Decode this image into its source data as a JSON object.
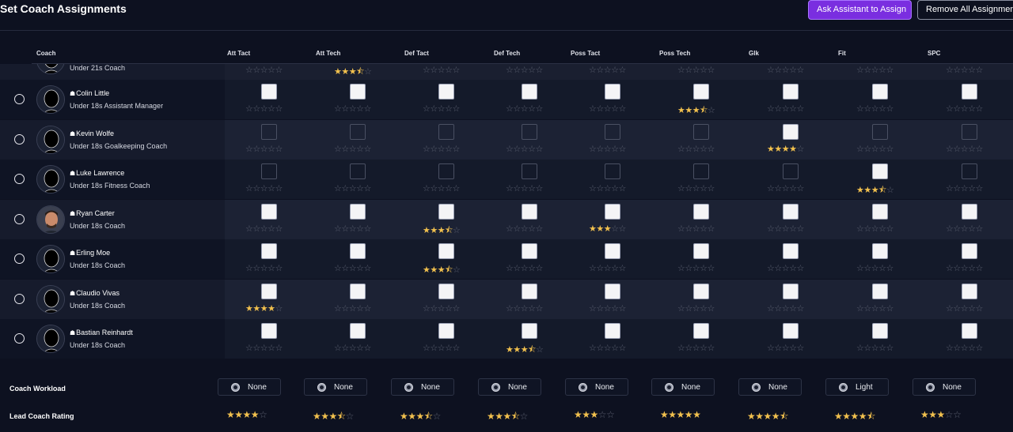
{
  "header": {
    "title": "Set Coach Assignments",
    "ask_assistant_label": "Ask Assistant to Assign",
    "remove_all_label": "Remove All Assignments"
  },
  "columns": {
    "coach": "Coach",
    "categories": [
      "Att Tact",
      "Att Tech",
      "Def Tact",
      "Def Tech",
      "Poss Tact",
      "Poss Tech",
      "Glk",
      "Fit",
      "SPC"
    ]
  },
  "colors": {
    "accent": "#7a2ee0",
    "star": "#f2c14e",
    "background": "#0d1120"
  },
  "partial_row": {
    "role": "Under 21s Coach",
    "ratings": [
      0,
      3.5,
      0,
      0,
      0,
      0,
      0,
      0,
      0
    ]
  },
  "rows": [
    {
      "name": "Colin Little",
      "role": "Under 18s Assistant Manager",
      "avatar": "silhouette",
      "checkboxes": [
        1,
        1,
        1,
        1,
        1,
        1,
        1,
        1,
        1
      ],
      "ratings": [
        0,
        0,
        0,
        0,
        0,
        3.5,
        0,
        0,
        0
      ]
    },
    {
      "name": "Kevin Wolfe",
      "role": "Under 18s Goalkeeping Coach",
      "avatar": "silhouette",
      "checkboxes": [
        0,
        0,
        0,
        0,
        0,
        0,
        1,
        0,
        0
      ],
      "ratings": [
        0,
        0,
        0,
        0,
        0,
        0,
        4,
        0,
        0
      ]
    },
    {
      "name": "Luke Lawrence",
      "role": "Under 18s Fitness Coach",
      "avatar": "silhouette",
      "checkboxes": [
        0,
        0,
        0,
        0,
        0,
        0,
        0,
        1,
        0
      ],
      "ratings": [
        0,
        0,
        0,
        0,
        0,
        0,
        0,
        3.5,
        0
      ]
    },
    {
      "name": "Ryan Carter",
      "role": "Under 18s Coach",
      "avatar": "photo",
      "checkboxes": [
        1,
        1,
        1,
        1,
        1,
        1,
        1,
        1,
        1
      ],
      "ratings": [
        0,
        0,
        3.5,
        0,
        3,
        0,
        0,
        0,
        0
      ]
    },
    {
      "name": "Erling Moe",
      "role": "Under 18s Coach",
      "avatar": "silhouette",
      "checkboxes": [
        1,
        1,
        1,
        1,
        1,
        1,
        1,
        1,
        1
      ],
      "ratings": [
        0,
        0,
        3.5,
        0,
        0,
        0,
        0,
        0,
        0
      ]
    },
    {
      "name": "Claudio Vivas",
      "role": "Under 18s Coach",
      "avatar": "silhouette",
      "checkboxes": [
        1,
        1,
        1,
        1,
        1,
        1,
        1,
        1,
        1
      ],
      "ratings": [
        4,
        0,
        0,
        0,
        0,
        0,
        0,
        0,
        0
      ]
    },
    {
      "name": "Bastian Reinhardt",
      "role": "Under 18s Coach",
      "avatar": "silhouette",
      "checkboxes": [
        1,
        1,
        1,
        1,
        1,
        1,
        1,
        1,
        1
      ],
      "ratings": [
        0,
        0,
        0,
        3.5,
        0,
        0,
        0,
        0,
        0
      ]
    }
  ],
  "footer": {
    "workload_label": "Coach Workload",
    "lead_rating_label": "Lead Coach Rating",
    "workload": [
      "None",
      "None",
      "None",
      "None",
      "None",
      "None",
      "None",
      "Light",
      "None"
    ],
    "lead_ratings": [
      4,
      3.5,
      3.5,
      3.5,
      3,
      5,
      4.5,
      4.5,
      3
    ]
  }
}
